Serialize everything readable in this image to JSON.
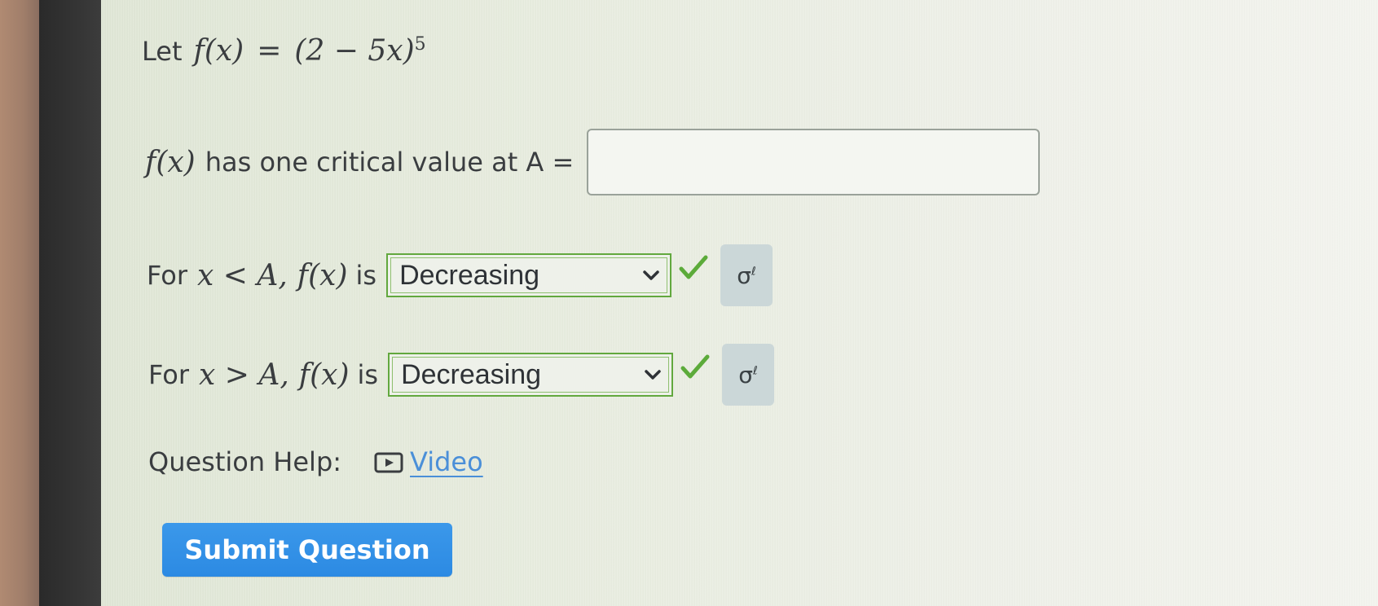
{
  "question": {
    "line1": {
      "prefix": "Let",
      "lhs": "f(x)",
      "eq": "=",
      "rhs": "(2 − 5x)",
      "exponent": "5"
    },
    "line2": {
      "func": "f(x)",
      "text": "has one critical value at A =",
      "input_value": ""
    },
    "line3": {
      "prefix": "For",
      "condition": "x < A,",
      "func": "f(x)",
      "is": "is",
      "selected": "Decreasing"
    },
    "line4": {
      "prefix": "For",
      "condition": "x > A,",
      "func": "f(x)",
      "is": "is",
      "selected": "Decreasing"
    },
    "help": {
      "label": "Question Help:",
      "link": "Video"
    }
  },
  "submit_label": "Submit Question",
  "colors": {
    "check": "#5cab3a",
    "select_border": "#62a83e",
    "submit_bg": "#3b98ea",
    "link": "#4a8fd8"
  },
  "icons": {
    "correct": "checkmark-icon",
    "equation": "equation-editor-icon",
    "video": "play-icon",
    "dropdown": "chevron-down-icon"
  }
}
